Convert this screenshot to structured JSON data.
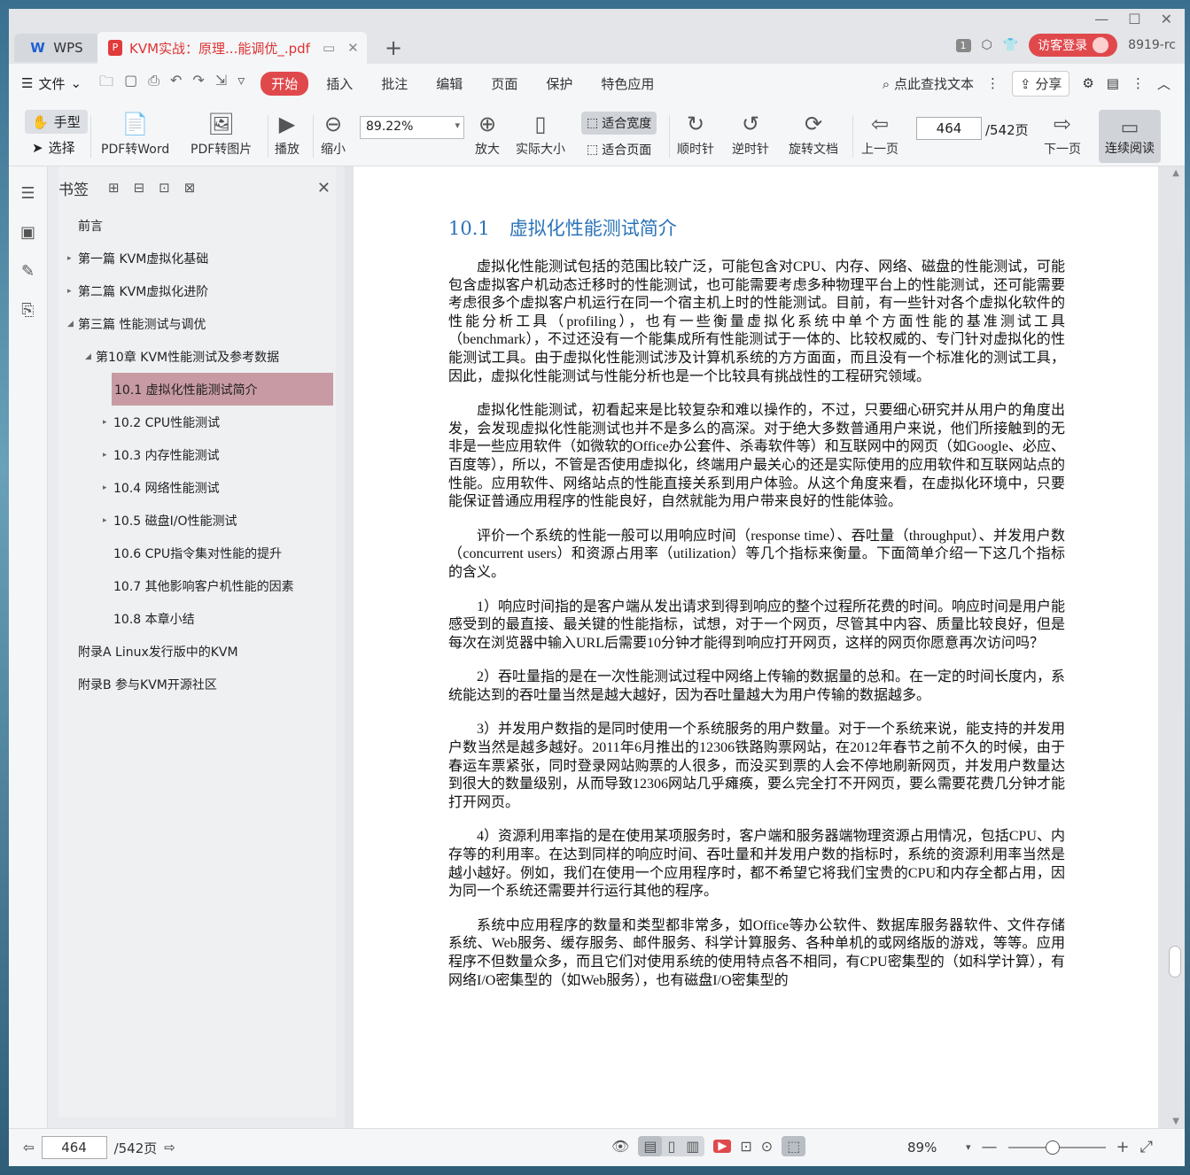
{
  "tabs": {
    "app_label": "WPS",
    "doc_title": "KVM实战：原理...能调优_.pdf"
  },
  "top_right": {
    "badge": "1",
    "login_label": "访客登录",
    "version": "8919-rc"
  },
  "menu": {
    "file_label": "文件",
    "items": [
      "开始",
      "插入",
      "批注",
      "编辑",
      "页面",
      "保护",
      "特色应用"
    ],
    "search_label": "点此查找文本",
    "share_label": "分享"
  },
  "toolbar": {
    "hand_label": "手型",
    "select_label": "选择",
    "pdf_to_word": "PDF转Word",
    "pdf_to_image": "PDF转图片",
    "play": "播放",
    "zoom_out": "缩小",
    "zoom_value": "89.22%",
    "zoom_in": "放大",
    "actual_size": "实际大小",
    "fit_width": "适合宽度",
    "fit_page": "适合页面",
    "clockwise": "顺时针",
    "counter_clockwise": "逆时针",
    "rotate_doc": "旋转文档",
    "prev_page": "上一页",
    "page_number": "464",
    "page_total": "/542页",
    "next_page": "下一页",
    "continuous": "连续阅读"
  },
  "bookmarks": {
    "title": "书签",
    "items": [
      {
        "label": "前言",
        "level": 0,
        "arrow": ""
      },
      {
        "label": "第一篇 KVM虚拟化基础",
        "level": 0,
        "arrow": "▸"
      },
      {
        "label": "第二篇 KVM虚拟化进阶",
        "level": 0,
        "arrow": "▸"
      },
      {
        "label": "第三篇 性能测试与调优",
        "level": 0,
        "arrow": "◢"
      },
      {
        "label": "第10章 KVM性能测试及参考数据",
        "level": 1,
        "arrow": "◢"
      },
      {
        "label": "10.1 虚拟化性能测试简介",
        "level": 2,
        "arrow": "",
        "selected": true
      },
      {
        "label": "10.2 CPU性能测试",
        "level": 2,
        "arrow": "▸"
      },
      {
        "label": "10.3 内存性能测试",
        "level": 2,
        "arrow": "▸"
      },
      {
        "label": "10.4 网络性能测试",
        "level": 2,
        "arrow": "▸"
      },
      {
        "label": "10.5 磁盘I/O性能测试",
        "level": 2,
        "arrow": "▸"
      },
      {
        "label": "10.6 CPU指令集对性能的提升",
        "level": 2,
        "arrow": ""
      },
      {
        "label": "10.7 其他影响客户机性能的因素",
        "level": 2,
        "arrow": ""
      },
      {
        "label": "10.8 本章小结",
        "level": 2,
        "arrow": ""
      },
      {
        "label": "附录A Linux发行版中的KVM",
        "level": 0,
        "arrow": ""
      },
      {
        "label": "附录B 参与KVM开源社区",
        "level": 0,
        "arrow": ""
      }
    ]
  },
  "page": {
    "section_num": "10.1",
    "section_title": "虚拟化性能测试简介",
    "paragraphs": [
      "虚拟化性能测试包括的范围比较广泛，可能包含对CPU、内存、网络、磁盘的性能测试，可能包含虚拟客户机动态迁移时的性能测试，也可能需要考虑多种物理平台上的性能测试，还可能需要考虑很多个虚拟客户机运行在同一个宿主机上时的性能测试。目前，有一些针对各个虚拟化软件的性能分析工具（profiling），也有一些衡量虚拟化系统中单个方面性能的基准测试工具（benchmark），不过还没有一个能集成所有性能测试于一体的、比较权威的、专门针对虚拟化的性能测试工具。由于虚拟化性能测试涉及计算机系统的方方面面，而且没有一个标准化的测试工具，因此，虚拟化性能测试与性能分析也是一个比较具有挑战性的工程研究领域。",
      "虚拟化性能测试，初看起来是比较复杂和难以操作的，不过，只要细心研究并从用户的角度出发，会发现虚拟化性能测试也并不是多么的高深。对于绝大多数普通用户来说，他们所接触到的无非是一些应用软件（如微软的Office办公套件、杀毒软件等）和互联网中的网页（如Google、必应、百度等），所以，不管是否使用虚拟化，终端用户最关心的还是实际使用的应用软件和互联网站点的性能。应用软件、网络站点的性能直接关系到用户体验。从这个角度来看，在虚拟化环境中，只要能保证普通应用程序的性能良好，自然就能为用户带来良好的性能体验。",
      "评价一个系统的性能一般可以用响应时间（response time）、吞吐量（throughput）、并发用户数（concurrent users）和资源占用率（utilization）等几个指标来衡量。下面简单介绍一下这几个指标的含义。",
      "1）响应时间指的是客户端从发出请求到得到响应的整个过程所花费的时间。响应时间是用户能感受到的最直接、最关键的性能指标，试想，对于一个网页，尽管其中内容、质量比较良好，但是每次在浏览器中输入URL后需要10分钟才能得到响应打开网页，这样的网页你愿意再次访问吗？",
      "2）吞吐量指的是在一次性能测试过程中网络上传输的数据量的总和。在一定的时间长度内，系统能达到的吞吐量当然是越大越好，因为吞吐量越大为用户传输的数据越多。",
      "3）并发用户数指的是同时使用一个系统服务的用户数量。对于一个系统来说，能支持的并发用户数当然是越多越好。2011年6月推出的12306铁路购票网站，在2012年春节之前不久的时候，由于春运车票紧张，同时登录网站购票的人很多，而没买到票的人会不停地刷新网页，并发用户数量达到很大的数量级别，从而导致12306网站几乎瘫痪，要么完全打不开网页，要么需要花费几分钟才能打开网页。",
      "4）资源利用率指的是在使用某项服务时，客户端和服务器端物理资源占用情况，包括CPU、内存等的利用率。在达到同样的响应时间、吞吐量和并发用户数的指标时，系统的资源利用率当然是越小越好。例如，我们在使用一个应用程序时，都不希望它将我们宝贵的CPU和内存全都占用，因为同一个系统还需要并行运行其他的程序。",
      "系统中应用程序的数量和类型都非常多，如Office等办公软件、数据库服务器软件、文件存储系统、Web服务、缓存服务、邮件服务、科学计算服务、各种单机的或网络版的游戏，等等。应用程序不但数量众多，而且它们对使用系统的使用特点各不相同，有CPU密集型的（如科学计算），有网络I/O密集型的（如Web服务），也有磁盘I/O密集型的"
    ]
  },
  "status": {
    "page_number": "464",
    "page_total": "/542页",
    "zoom": "89%"
  }
}
